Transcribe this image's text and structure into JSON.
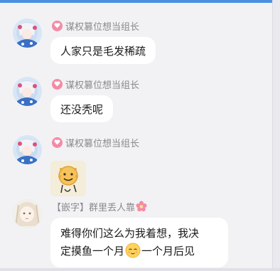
{
  "messages": [
    {
      "sender": "谋权篡位想当组长",
      "text": "人家只是毛发稀疏",
      "sender_icon": "heart-badge-icon"
    },
    {
      "sender": "谋权篡位想当组长",
      "text": "还没秃呢",
      "sender_icon": "heart-badge-icon"
    },
    {
      "sender": "谋权篡位想当组长",
      "sticker": "smiley-ball-sticker",
      "sender_icon": "heart-badge-icon"
    },
    {
      "sender": "【嵌字】群里丢人靠",
      "text_line1": "难得你们这么为我着想，我决",
      "text_line2_a": "定摸鱼一个月",
      "text_line2_b": "一个月后见",
      "emoji": "relieved-face-emoji",
      "sender_icon": "pink-flower-icon"
    }
  ],
  "colors": {
    "background": "#f2f2f4",
    "bubble": "#ffffff",
    "sender_name": "#8a8a8f",
    "heart_badge": "#f48aa6",
    "top_bar": "#4a90e2"
  }
}
